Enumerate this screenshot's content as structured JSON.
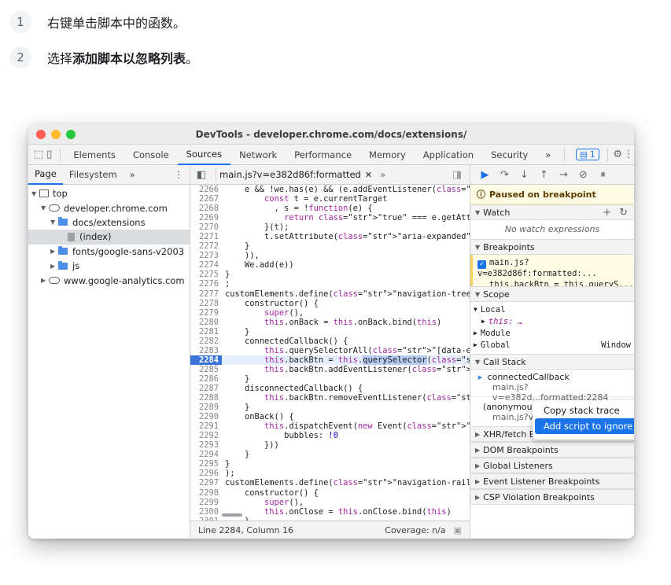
{
  "steps": [
    {
      "num": "1",
      "text": "右键单击脚本中的函数。"
    },
    {
      "num": "2",
      "prefix": "选择",
      "bold": "添加脚本以忽略列表",
      "suffix": "。"
    }
  ],
  "window": {
    "title": "DevTools - developer.chrome.com/docs/extensions/"
  },
  "main_tabs": [
    "Elements",
    "Console",
    "Sources",
    "Network",
    "Performance",
    "Memory",
    "Application",
    "Security"
  ],
  "main_tabs_active": "Sources",
  "more_tabs": "»",
  "issues_badge": "1",
  "left_tabs": [
    "Page",
    "Filesystem"
  ],
  "left_more": "»",
  "tree": [
    {
      "label": "top",
      "indent": 0,
      "icon": "frame",
      "tri": "▼"
    },
    {
      "label": "developer.chrome.com",
      "indent": 1,
      "icon": "cloud",
      "tri": "▼"
    },
    {
      "label": "docs/extensions",
      "indent": 2,
      "icon": "folder",
      "tri": "▼"
    },
    {
      "label": "(index)",
      "indent": 3,
      "icon": "file",
      "tri": "",
      "selected": true
    },
    {
      "label": "fonts/google-sans-v2003",
      "indent": 2,
      "icon": "folder",
      "tri": "▶"
    },
    {
      "label": "js",
      "indent": 2,
      "icon": "folder",
      "tri": "▶"
    },
    {
      "label": "www.google-analytics.com",
      "indent": 1,
      "icon": "cloud",
      "tri": "▶"
    }
  ],
  "editor_tab": "main.js?v=e382d86f:formatted",
  "editor_more": "»",
  "code_lines": [
    {
      "n": "2266",
      "t": "    e && !we.has(e) && (e.addEventListener(\"click\","
    },
    {
      "n": "2267",
      "t": "        const t = e.currentTarget"
    },
    {
      "n": "2268",
      "t": "          , s = !function(e) {"
    },
    {
      "n": "2269",
      "t": "            return \"true\" === e.getAttribute(\"aria-"
    },
    {
      "n": "2270",
      "t": "        }(t);"
    },
    {
      "n": "2271",
      "t": "        t.setAttribute(\"aria-expanded\", s ? \"true\""
    },
    {
      "n": "2272",
      "t": "    }"
    },
    {
      "n": "2273",
      "t": "    )),"
    },
    {
      "n": "2274",
      "t": "    We.add(e))"
    },
    {
      "n": "2275",
      "t": "}"
    },
    {
      "n": "2276",
      "t": ";"
    },
    {
      "n": "2277",
      "t": "customElements.define(\"navigation-tree\", class exte"
    },
    {
      "n": "2278",
      "t": "    constructor() {"
    },
    {
      "n": "2279",
      "t": "        super(),"
    },
    {
      "n": "2280",
      "t": "        this.onBack = this.onBack.bind(this)"
    },
    {
      "n": "2281",
      "t": "    }"
    },
    {
      "n": "2282",
      "t": "    connectedCallback() {"
    },
    {
      "n": "2283",
      "t": "        this.querySelectorAll(\"[data-expandable]\")."
    },
    {
      "n": "2284",
      "t": "        this.backBtn = this.querySelector(\".navigat",
      "bp": true
    },
    {
      "n": "2285",
      "t": "        this.backBtn.addEventListener(\"click\", this"
    },
    {
      "n": "2286",
      "t": "    }"
    },
    {
      "n": "2287",
      "t": "    disconnectedCallback() {"
    },
    {
      "n": "2288",
      "t": "        this.backBtn.removeEventListener(\"click\", t"
    },
    {
      "n": "2289",
      "t": "    }"
    },
    {
      "n": "2290",
      "t": "    onBack() {"
    },
    {
      "n": "2291",
      "t": "        this.dispatchEvent(new Event(\"navigation-tr"
    },
    {
      "n": "2292",
      "t": "            bubbles: !0"
    },
    {
      "n": "2293",
      "t": "        }))"
    },
    {
      "n": "2294",
      "t": "    }"
    },
    {
      "n": "2295",
      "t": "}"
    },
    {
      "n": "2296",
      "t": ");"
    },
    {
      "n": "2297",
      "t": "customElements.define(\"navigation-rail\", class exte"
    },
    {
      "n": "2298",
      "t": "    constructor() {"
    },
    {
      "n": "2299",
      "t": "        super(),"
    },
    {
      "n": "2300",
      "t": "        this.onClose = this.onClose.bind(this)"
    },
    {
      "n": "2301",
      "t": "    }"
    }
  ],
  "status": {
    "position": "Line 2284, Column 16",
    "coverage": "Coverage: n/a"
  },
  "debugger": {
    "paused": "Paused on breakpoint",
    "watch": "Watch",
    "no_watch": "No watch expressions",
    "breakpoints": "Breakpoints",
    "bp_file": "main.js?v=e382d86f:formatted:...",
    "bp_code": "this.backBtn = this.queryS...",
    "scope": "Scope",
    "scope_local": "Local",
    "scope_this": "this: …",
    "scope_module": "Module",
    "scope_global": "Global",
    "scope_window": "Window",
    "call_stack": "Call Stack",
    "stack": [
      {
        "fn": "connectedCallback",
        "loc": "main.js?v=e382d...formatted:2284",
        "current": true
      },
      {
        "fn": "(anonymous)",
        "loc": "main.js?v="
      }
    ],
    "sections": [
      "XHR/fetch Breakpoints",
      "DOM Breakpoints",
      "Global Listeners",
      "Event Listener Breakpoints",
      "CSP Violation Breakpoints"
    ],
    "xhr_short": "XHR/fetch B"
  },
  "context_menu": [
    "Copy stack trace",
    "Add script to ignore list"
  ]
}
